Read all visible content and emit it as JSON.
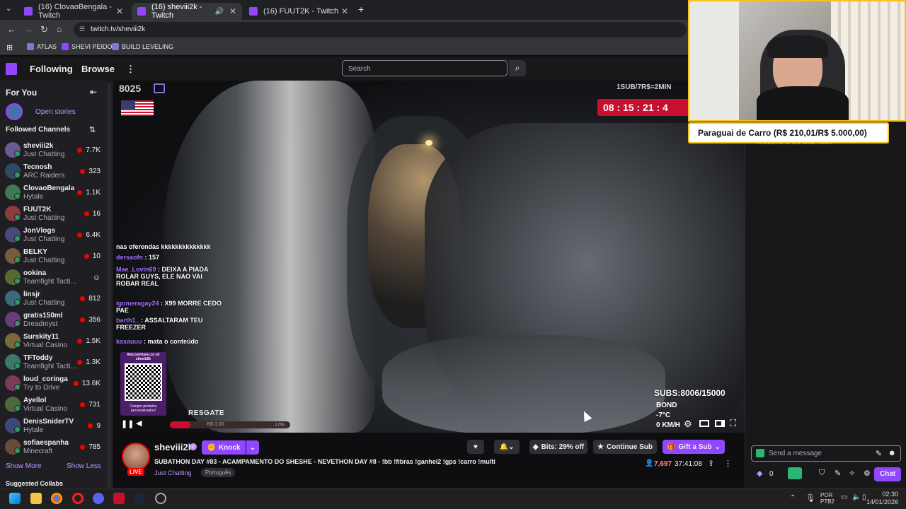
{
  "browser": {
    "tabs": [
      {
        "label": "(16) ClovaoBengala - Twitch",
        "close": "✕"
      },
      {
        "label": "(16) sheviii2k - Twitch",
        "close": "✕"
      },
      {
        "label": "(16) FUUT2K - Twitch",
        "close": "✕"
      }
    ],
    "new_tab": "+",
    "url": "twitch.tv/sheviii2k",
    "bookmarks": [
      "ATLAS",
      "SHEVI PEIDO",
      "BUILD LEVELING"
    ]
  },
  "twitch_nav": {
    "following": "Following",
    "browse": "Browse",
    "more": "⋮",
    "search_placeholder": "Search"
  },
  "sidebar": {
    "for_you": "For You",
    "open_stories": "Open stories",
    "followed_channels": "Followed Channels",
    "channels": [
      {
        "name": "sheviii2k",
        "game": "Just Chatting",
        "viewers": "7.7K"
      },
      {
        "name": "Tecnosh",
        "game": "ARC Raiders",
        "viewers": "323"
      },
      {
        "name": "ClovaoBengala",
        "game": "Hytale",
        "viewers": "1.1K"
      },
      {
        "name": "FUUT2K",
        "game": "Just Chatting",
        "viewers": "16"
      },
      {
        "name": "JonVlogs",
        "game": "Just Chatting",
        "viewers": "6.4K"
      },
      {
        "name": "BELKY",
        "game": "Just Chatting",
        "viewers": "10"
      },
      {
        "name": "ookina",
        "game": "Teamfight Tacti...",
        "viewers": ""
      },
      {
        "name": "linsjr",
        "game": "Just Chatting",
        "viewers": "812"
      },
      {
        "name": "gratis150ml",
        "game": "Dreadmyst",
        "viewers": "356"
      },
      {
        "name": "Surskity11",
        "game": "Virtual Casino",
        "viewers": "1.5K"
      },
      {
        "name": "TFToddy",
        "game": "Teamfight Tacti...",
        "viewers": "1.3K"
      },
      {
        "name": "loud_coringa",
        "game": "Try to Drive",
        "viewers": "13.6K"
      },
      {
        "name": "Ayellol",
        "game": "Virtual Casino",
        "viewers": "731"
      },
      {
        "name": "DenisSniderTV",
        "game": "Hytale",
        "viewers": "9"
      },
      {
        "name": "sofiaespanha",
        "game": "Minecraft",
        "viewers": "785"
      }
    ],
    "show_more": "Show More",
    "show_less": "Show Less",
    "suggested": "Suggested Collabs"
  },
  "video": {
    "counter": "8025",
    "sub_rate": "1SUB/7R$=2MIN",
    "timer": "08 : 15 : 21 : 4",
    "chat": [
      {
        "user": "",
        "text": "nas oferendas kkkkkkkkkkkkkk"
      },
      {
        "user": "dersaofn",
        "text": ": 157"
      },
      {
        "user": "Mae_Lovin69",
        "text": ": DEIXA A PIADA ROLAR GUYS, ELE NAO VAI ROBAR REAL"
      },
      {
        "user": "igomeragay24",
        "text": ": X99 MORRE CEDO PAE"
      },
      {
        "user": "barth1_",
        "text": ": ASSALTARAM TEU FREEZER"
      },
      {
        "user": "kaxauuu",
        "text": ": mata o conteúdo"
      }
    ],
    "qr_caption_top": "thecoolrhyno.co m/ sheviii2k",
    "qr_caption_bottom": "Compre produtos personalizados!",
    "resgate": "RESGATE",
    "progress_label": "R$ 0,00",
    "progress_pct": "17%",
    "subs": "SUBS:8006/15000",
    "bond": "BOND",
    "temp": "-7°C",
    "speed": "0 KM/H"
  },
  "stream": {
    "channel": "sheviii2k",
    "live": "LIVE",
    "knock": "Knock",
    "bits": "Bits: 29% off",
    "continue_sub": "Continue Sub",
    "gift_sub": "Gift a Sub",
    "title": "SUBATHON DAY #83 - ACAMPAMENTO DO SHESHE - NEVETHON DAY #8 - !bb !fibras !ganhei2 !gps !carro !multi",
    "category": "Just Chatting",
    "tag": "Português",
    "viewers": "7,697",
    "uptime": "37:41:08"
  },
  "chat_panel": {
    "welcome": "Welcome to the chat room!",
    "placeholder": "Send a message",
    "points": "0",
    "chat_button": "Chat"
  },
  "overlay": {
    "goal": "Paraguai de Carro (R$ 210,01/R$ 5.000,00)"
  },
  "taskbar": {
    "lang1": "POR",
    "lang2": "PTB2",
    "time": "02:30",
    "date": "14/01/2026"
  },
  "colors": {
    "twitch_purple": "#9146ff",
    "live_red": "#eb0400",
    "goal_border": "#f7c21b",
    "timer_red": "#c8102e"
  }
}
